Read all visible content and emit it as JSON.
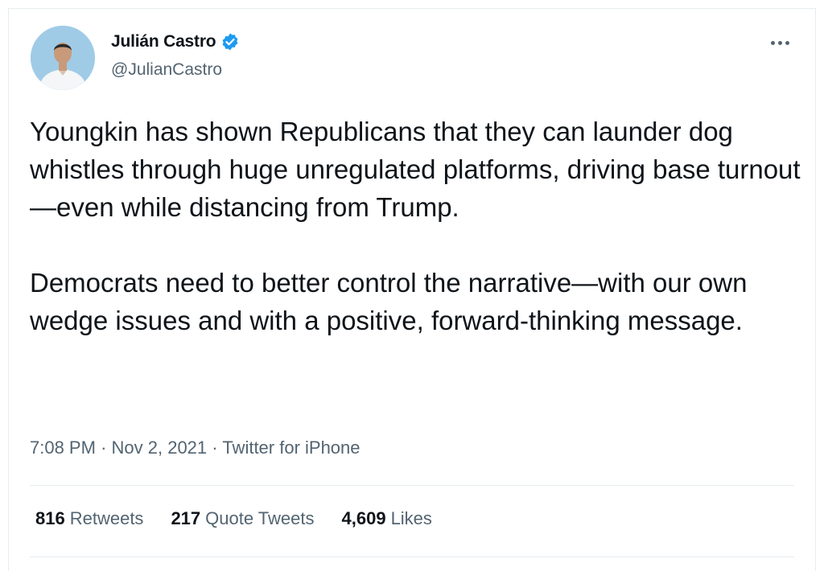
{
  "tweet": {
    "author_name": "Julián Castro",
    "author_handle": "@JulianCastro",
    "verified": true,
    "paragraphs": [
      "Youngkin has shown Republicans that they can launder dog whistles through huge unregulated platforms, driving base turnout—even while distancing from Trump.",
      "Democrats need to better control the narrative—with our own wedge issues and with a positive, forward-thinking message."
    ],
    "time": "7:08 PM",
    "separator": "·",
    "date": "Nov 2, 2021",
    "source": "Twitter for iPhone"
  },
  "stats": {
    "retweets_count": "816",
    "retweets_label": "Retweets",
    "quotes_count": "217",
    "quotes_label": "Quote Tweets",
    "likes_count": "4,609",
    "likes_label": "Likes"
  },
  "colors": {
    "text": "#0f1419",
    "secondary": "#536471",
    "verified": "#1d9bf0",
    "divider": "#e6ecf0"
  },
  "icons": {
    "verified": "verified-badge-icon",
    "more": "more-options-icon"
  }
}
